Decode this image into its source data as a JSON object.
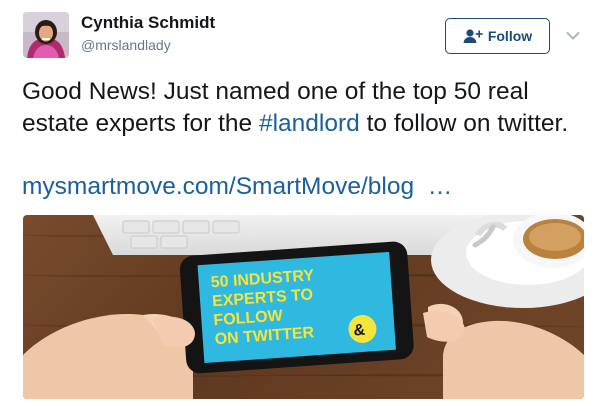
{
  "author": {
    "name": "Cynthia Schmidt",
    "handle": "@mrslandlady",
    "avatar_icon": "profile-photo"
  },
  "follow_button": {
    "label": "Follow",
    "icon": "add-user-icon",
    "color": "#1b4a7a"
  },
  "more_menu": {
    "icon": "chevron-down-icon"
  },
  "tweet": {
    "text_before": "Good News! Just named one of the top 50 real estate experts for the ",
    "hashtag": "#landlord",
    "text_after": " to follow on twitter.",
    "link_text": "mysmartmove.com/SmartMove/blog",
    "link_ellipsis": "…"
  },
  "media": {
    "phone_screen_lines": [
      "50 INDUSTRY",
      "EXPERTS TO",
      "FOLLOW",
      "ON TWITTER"
    ],
    "badge_icon": "smartmove-logo-icon",
    "screen_color": "#2fb8e0",
    "text_color": "#f5e43a"
  },
  "colors": {
    "link": "#1b5fa0",
    "handle": "#657786"
  }
}
